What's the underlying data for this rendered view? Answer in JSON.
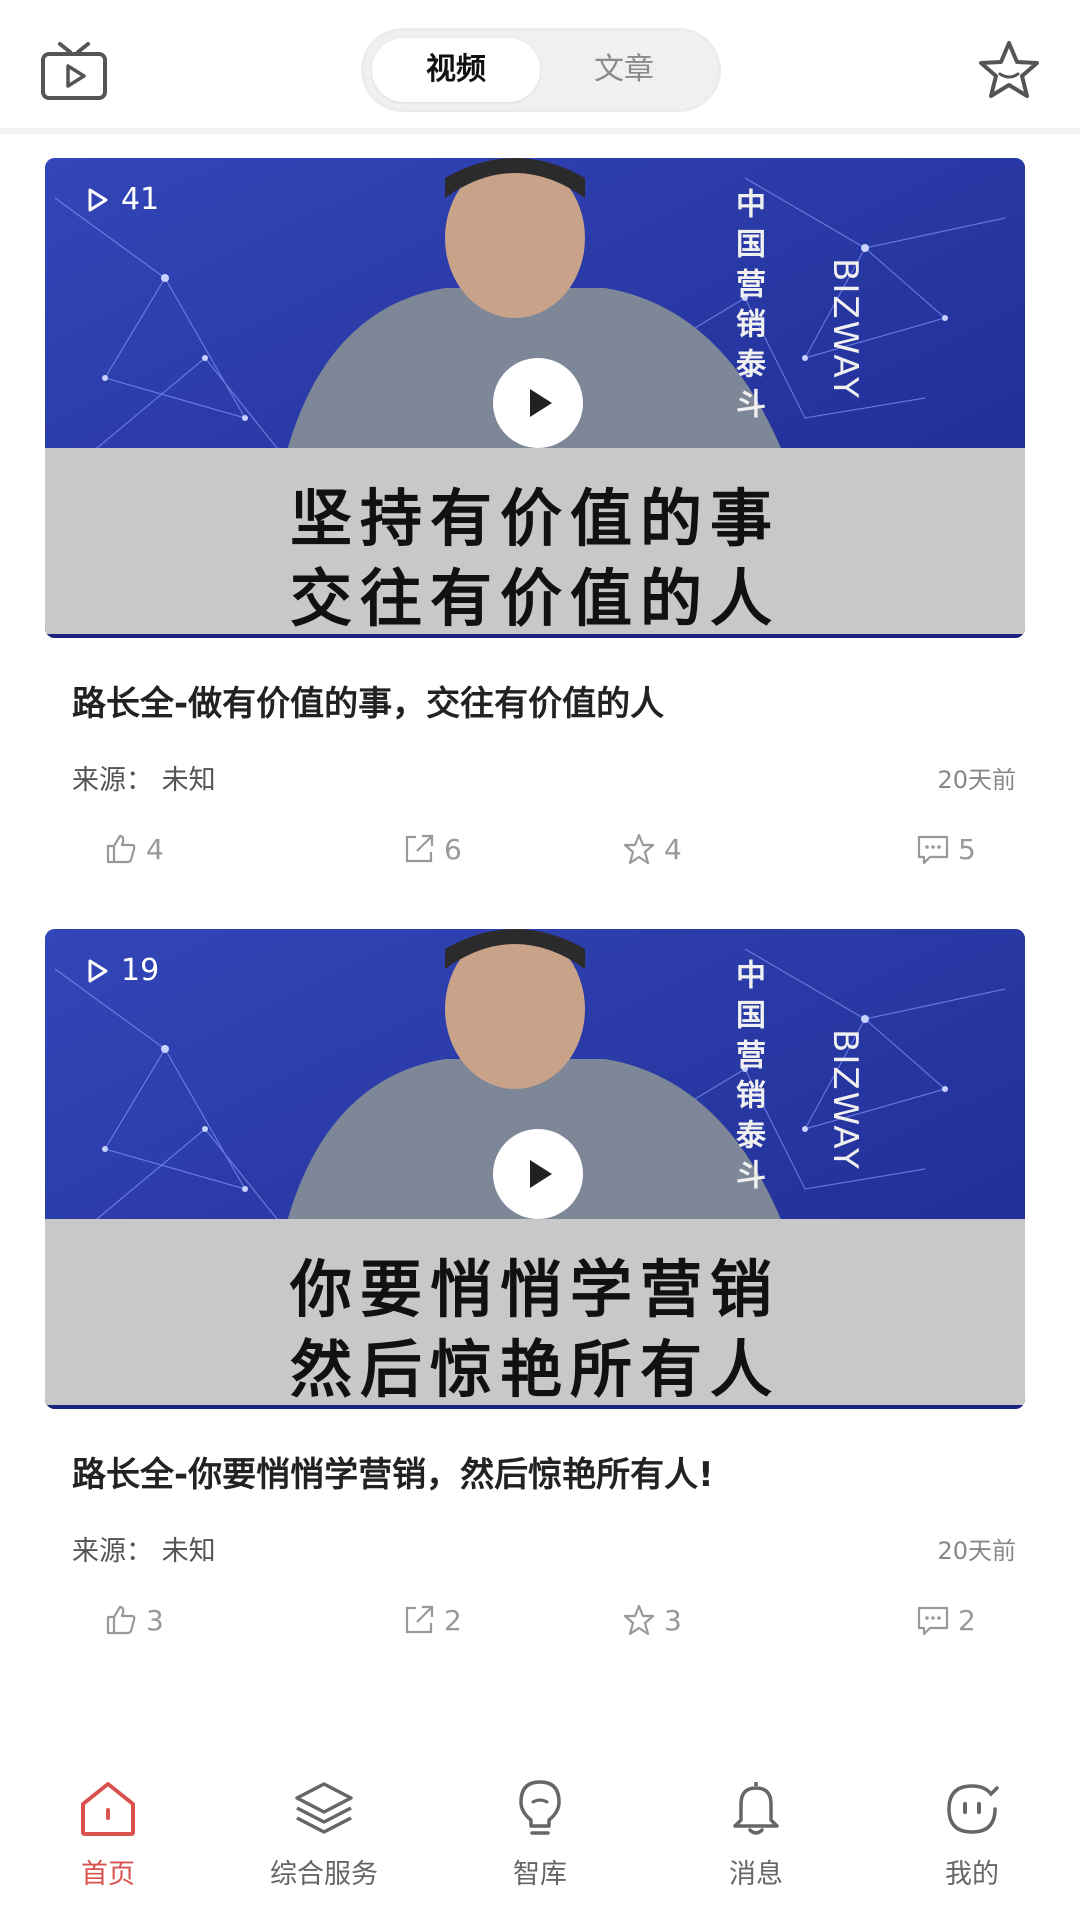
{
  "header": {
    "left_icon": "tv-icon",
    "right_icon": "star-icon",
    "tabs": [
      {
        "label": "视频",
        "active": true
      },
      {
        "label": "文章",
        "active": false
      }
    ]
  },
  "cards": [
    {
      "views": "41",
      "thumbnail_caption": [
        "坚持有价值的事",
        "交往有价值的人"
      ],
      "thumbnail_overlay_cn": "中国营销泰斗",
      "thumbnail_overlay_en": "BIZWAY",
      "title": "路长全-做有价值的事，交往有价值的人",
      "source": "来源：  未知",
      "time": "20天前",
      "likes": "4",
      "shares": "6",
      "favorites": "4",
      "comments": "5"
    },
    {
      "views": "19",
      "thumbnail_caption": [
        "你要悄悄学营销",
        "然后惊艳所有人"
      ],
      "thumbnail_overlay_cn": "中国营销泰斗",
      "thumbnail_overlay_en": "BIZWAY",
      "title": "路长全-你要悄悄学营销，然后惊艳所有人!",
      "source": "来源：  未知",
      "time": "20天前",
      "likes": "3",
      "shares": "2",
      "favorites": "3",
      "comments": "2"
    }
  ],
  "tabbar": {
    "items": [
      {
        "label": "首页",
        "icon": "home-icon",
        "active": true
      },
      {
        "label": "综合服务",
        "icon": "layers-icon",
        "active": false
      },
      {
        "label": "智库",
        "icon": "lightbulb-icon",
        "active": false
      },
      {
        "label": "消息",
        "icon": "bell-icon",
        "active": false
      },
      {
        "label": "我的",
        "icon": "smiley-icon",
        "active": false
      }
    ]
  },
  "colors": {
    "accent": "#d9534f",
    "thumb_blue": "#2a3da8",
    "caption_band": "#c8c8c8"
  }
}
